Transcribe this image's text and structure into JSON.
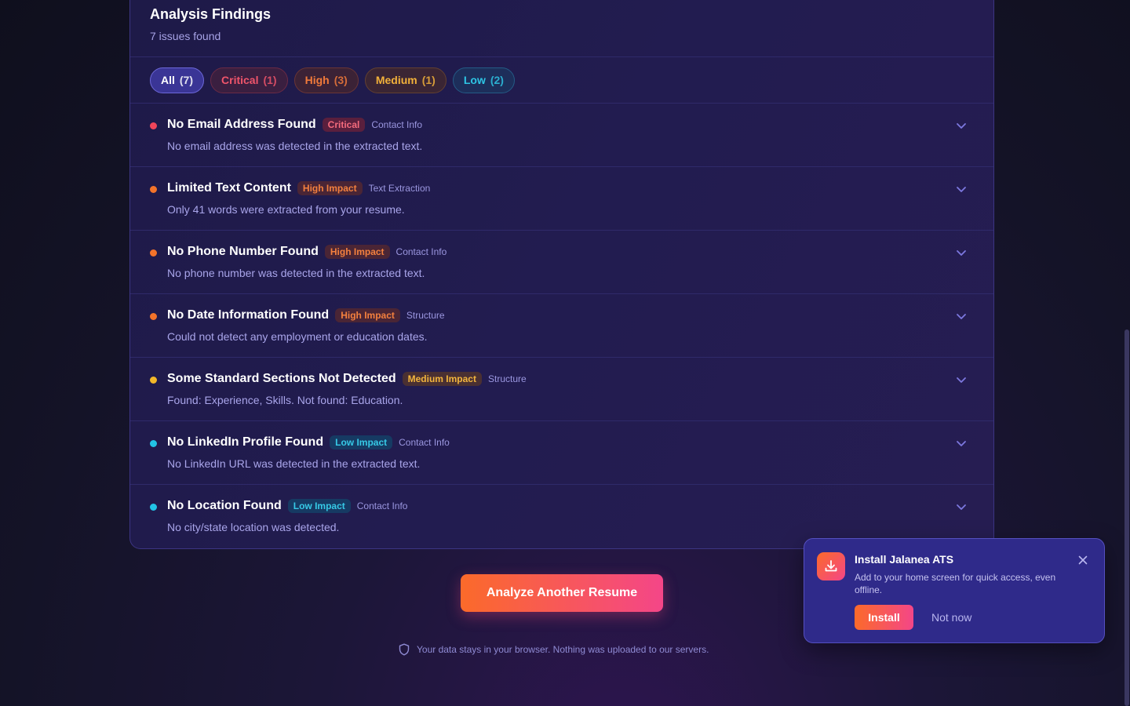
{
  "findings_panel": {
    "title": "Analysis Findings",
    "subtitle": "7 issues found"
  },
  "filters": [
    {
      "label": "All",
      "count": "(7)"
    },
    {
      "label": "Critical",
      "count": "(1)"
    },
    {
      "label": "High",
      "count": "(3)"
    },
    {
      "label": "Medium",
      "count": "(1)"
    },
    {
      "label": "Low",
      "count": "(2)"
    }
  ],
  "severity_colors": {
    "critical": "#f0455a",
    "high": "#f3732a",
    "medium": "#f2b729",
    "low": "#22c3e6"
  },
  "findings": [
    {
      "title": "No Email Address Found",
      "badge": "Critical",
      "category": "Contact Info",
      "description": "No email address was detected in the extracted text."
    },
    {
      "title": "Limited Text Content",
      "badge": "High Impact",
      "category": "Text Extraction",
      "description": "Only 41 words were extracted from your resume."
    },
    {
      "title": "No Phone Number Found",
      "badge": "High Impact",
      "category": "Contact Info",
      "description": "No phone number was detected in the extracted text."
    },
    {
      "title": "No Date Information Found",
      "badge": "High Impact",
      "category": "Structure",
      "description": "Could not detect any employment or education dates."
    },
    {
      "title": "Some Standard Sections Not Detected",
      "badge": "Medium Impact",
      "category": "Structure",
      "description": "Found: Experience, Skills. Not found: Education."
    },
    {
      "title": "No LinkedIn Profile Found",
      "badge": "Low Impact",
      "category": "Contact Info",
      "description": "No LinkedIn URL was detected in the extracted text."
    },
    {
      "title": "No Location Found",
      "badge": "Low Impact",
      "category": "Contact Info",
      "description": "No city/state location was detected."
    }
  ],
  "actions": {
    "analyze_again_label": "Analyze Another Resume"
  },
  "privacy_note": "Your data stays in your browser. Nothing was uploaded to our servers.",
  "install_toast": {
    "title": "Install Jalanea ATS",
    "text": "Add to your home screen for quick access, even offline.",
    "install_label": "Install",
    "dismiss_label": "Not now"
  },
  "icons": {
    "chevron": "chevron-down-icon",
    "shield": "shield-icon",
    "download": "download-icon",
    "close": "close-icon"
  }
}
